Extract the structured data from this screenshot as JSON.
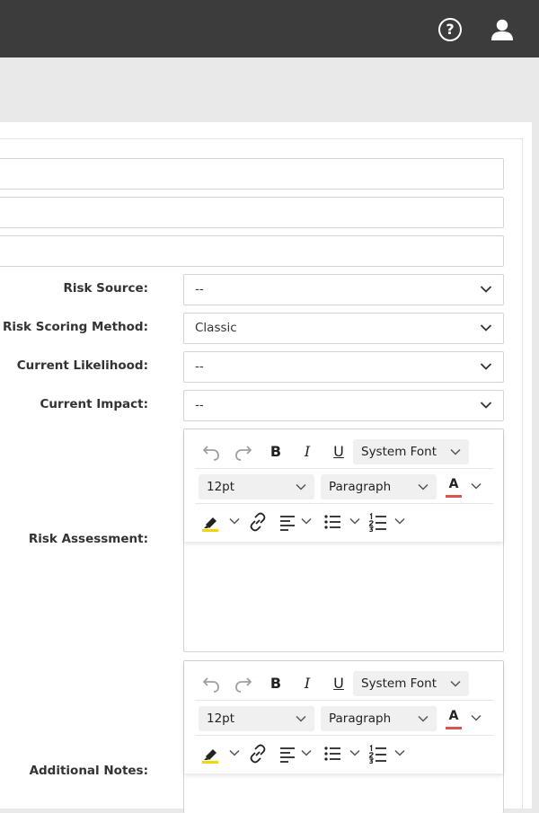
{
  "header": {
    "help_glyph": "?",
    "icons": [
      "help-icon",
      "user-icon"
    ],
    "bg_color": "#3c3c3c"
  },
  "form": {
    "fields": [
      {
        "label": "Risk Source:",
        "value": "--"
      },
      {
        "label": "Risk Scoring Method:",
        "value": "Classic"
      },
      {
        "label": "Current Likelihood:",
        "value": "--"
      },
      {
        "label": "Current Impact:",
        "value": "--"
      }
    ],
    "editors": [
      {
        "label": "Risk Assessment:"
      },
      {
        "label": "Additional Notes:"
      }
    ]
  },
  "editor_toolbar": {
    "bold": "B",
    "italic": "I",
    "underline": "U",
    "font_family": "System Font",
    "font_size": "12pt",
    "block_format": "Paragraph",
    "text_color_glyph": "A",
    "text_color": "#d9534f",
    "highlight_color": "#f2d600"
  }
}
